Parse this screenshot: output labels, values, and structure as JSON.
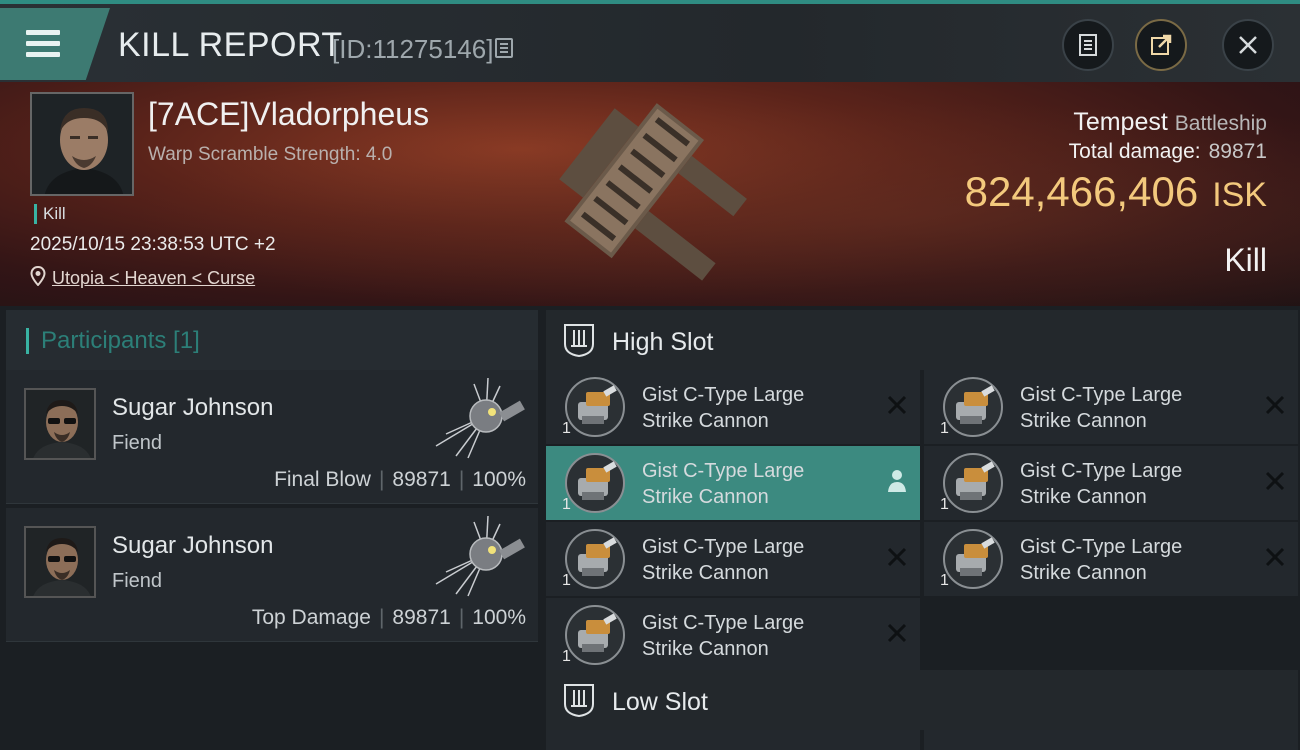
{
  "header": {
    "title": "KILL REPORT",
    "kill_id": "[ID:11275146]"
  },
  "victim": {
    "name": "[7ACE]Vladorpheus",
    "scramble": "Warp Scramble Strength: 4.0",
    "tag": "Kill",
    "datetime": "2025/10/15 23:38:53 UTC +2",
    "location": "Utopia < Heaven < Curse",
    "ship": "Tempest",
    "ship_class": "Battleship",
    "total_damage_label": "Total damage:",
    "total_damage": "89871",
    "isk_value": "824,466,406",
    "isk_unit": "ISK",
    "result": "Kill"
  },
  "participants": {
    "title": "Participants [1]",
    "items": [
      {
        "name": "Sugar Johnson",
        "ship": "Fiend",
        "label": "Final Blow",
        "damage": "89871",
        "percent": "100%"
      },
      {
        "name": "Sugar Johnson",
        "ship": "Fiend",
        "label": "Top Damage",
        "damage": "89871",
        "percent": "100%"
      }
    ]
  },
  "fitting": {
    "high_slot_label": "High Slot",
    "low_slot_label": "Low Slot",
    "high_modules": [
      {
        "line1": "Gist C-Type Large",
        "line2": "Strike Cannon",
        "qty": "1"
      },
      {
        "line1": "Gist C-Type Large",
        "line2": "Strike Cannon",
        "qty": "1"
      },
      {
        "line1": "Gist C-Type Large",
        "line2": "Strike Cannon",
        "qty": "1"
      },
      {
        "line1": "Gist C-Type Large",
        "line2": "Strike Cannon",
        "qty": "1"
      },
      {
        "line1": "Gist C-Type Large",
        "line2": "Strike Cannon",
        "qty": "1"
      },
      {
        "line1": "Gist C-Type Large",
        "line2": "Strike Cannon",
        "qty": "1"
      },
      {
        "line1": "Gist C-Type Large",
        "line2": "Strike Cannon",
        "qty": "1"
      }
    ]
  },
  "colors": {
    "accent": "#39b3a3",
    "isk": "#f3c97d",
    "selected": "#3c8a80"
  }
}
